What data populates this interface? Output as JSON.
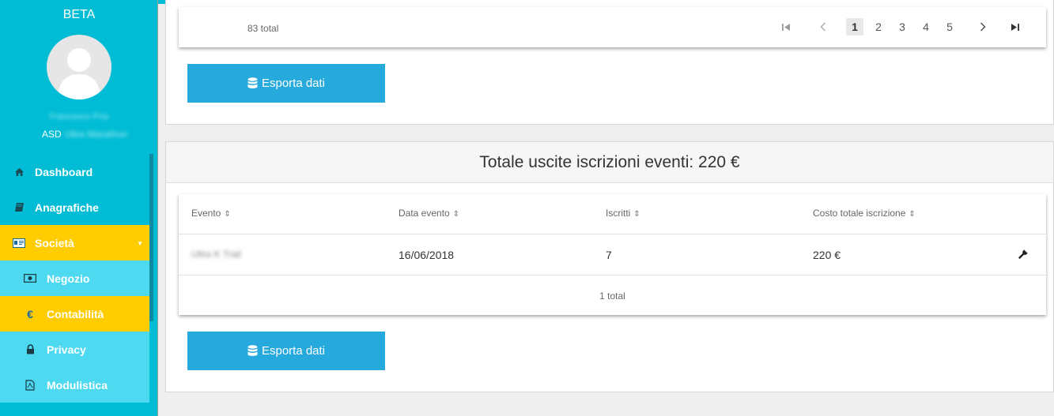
{
  "sidebar": {
    "beta_label": "BETA",
    "user_name": "Francesco Pria",
    "org_prefix": "ASD",
    "org_name": "Ultra Marathon",
    "menu": [
      {
        "label": "Dashboard",
        "icon": "home-icon"
      },
      {
        "label": "Anagrafiche",
        "icon": "book-icon"
      },
      {
        "label": "Società",
        "icon": "id-card-icon",
        "state": "active",
        "expanded": true
      },
      {
        "label": "Negozio",
        "icon": "money-icon",
        "submenu": true
      },
      {
        "label": "Contabilità",
        "icon": "euro-icon",
        "submenu": true,
        "state": "active"
      },
      {
        "label": "Privacy",
        "icon": "lock-icon",
        "submenu": true
      },
      {
        "label": "Modulistica",
        "icon": "pdf-file-icon",
        "submenu": true
      }
    ]
  },
  "top_section": {
    "total_text": "83 total",
    "pagination": {
      "pages": [
        "1",
        "2",
        "3",
        "4",
        "5"
      ],
      "current": "1"
    },
    "export_label": "Esporta dati"
  },
  "events_section": {
    "title": "Totale uscite iscrizioni eventi: 220 €",
    "columns": [
      "Evento",
      "Data evento",
      "Iscritti",
      "Costo totale iscrizione"
    ],
    "rows": [
      {
        "evento": "Ultra K Trail",
        "data": "16/06/2018",
        "iscritti": "7",
        "costo": "220 €"
      }
    ],
    "total_text": "1 total",
    "export_label": "Esporta dati"
  },
  "colors": {
    "sidebar": "#00bcd4",
    "submenu": "#4dd9f0",
    "active": "#ffcc00",
    "button": "#26a9dc"
  }
}
